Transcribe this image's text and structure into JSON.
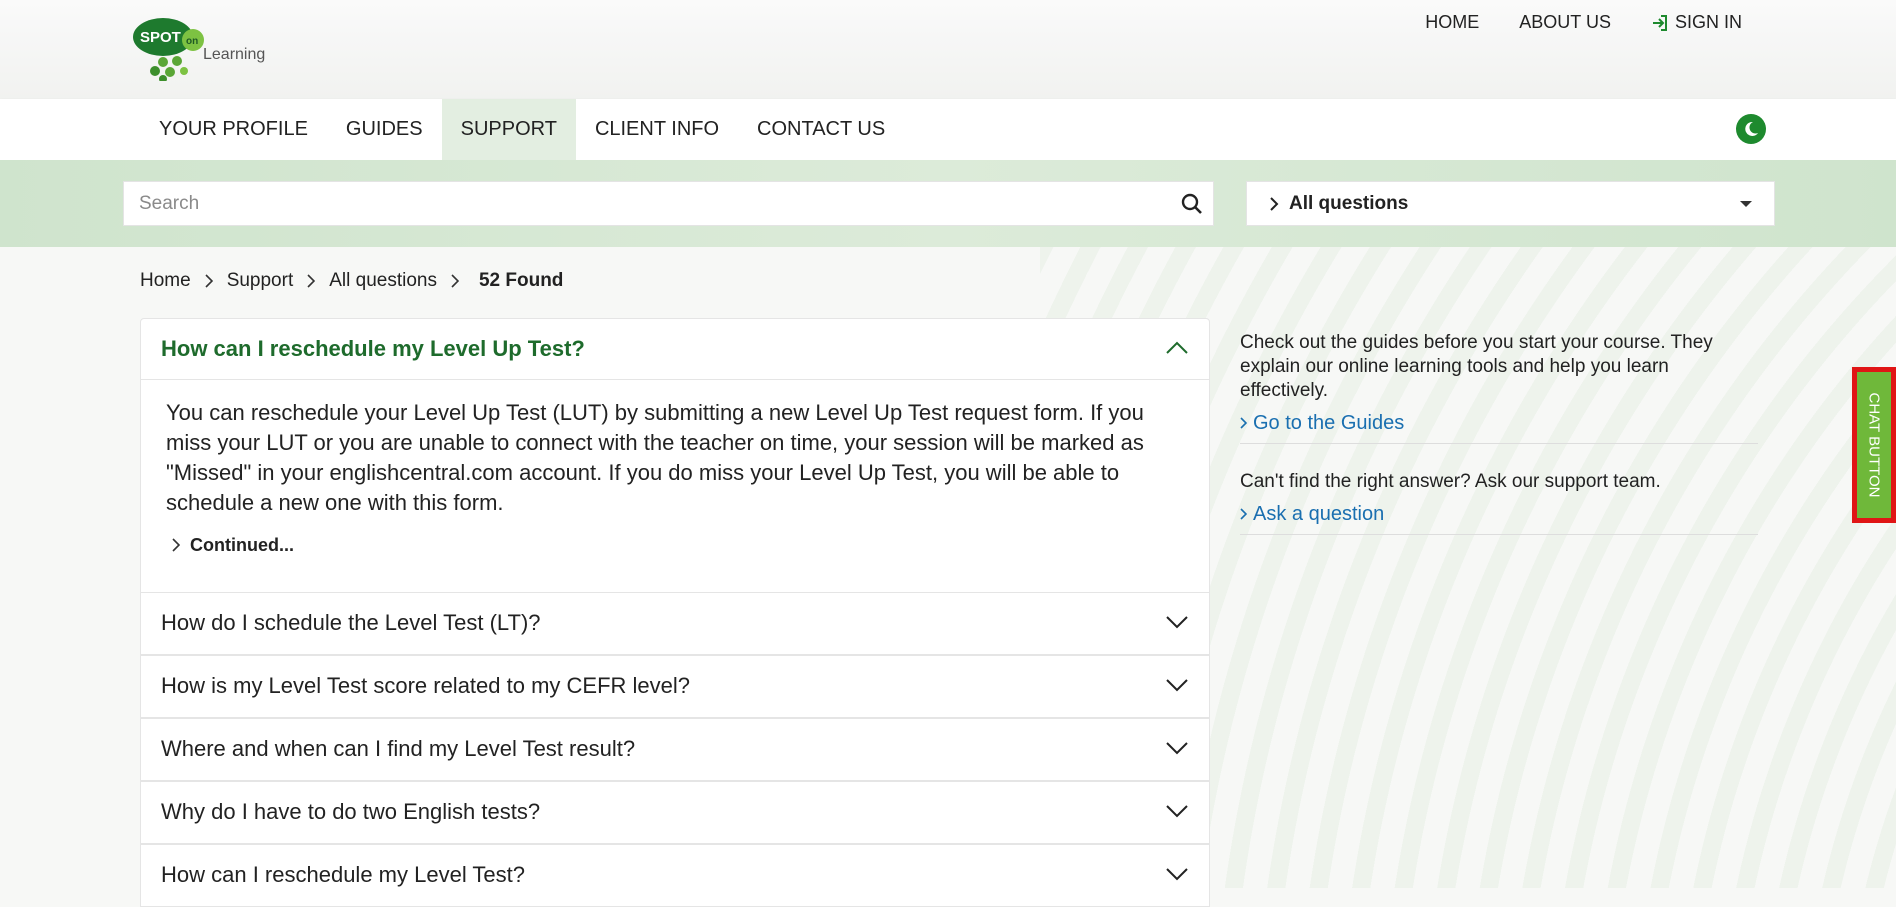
{
  "header": {
    "logo": {
      "spot": "SPOT",
      "on": "on",
      "learning": "Learning"
    },
    "links": [
      {
        "label": "HOME"
      },
      {
        "label": "ABOUT US"
      },
      {
        "label": "SIGN IN"
      }
    ]
  },
  "nav": {
    "items": [
      "YOUR PROFILE",
      "GUIDES",
      "SUPPORT",
      "CLIENT INFO",
      "CONTACT US"
    ],
    "active": "SUPPORT"
  },
  "search": {
    "placeholder": "Search",
    "value": ""
  },
  "filter": {
    "selected": "All questions"
  },
  "breadcrumb": {
    "items": [
      "Home",
      "Support",
      "All questions"
    ],
    "count": "52 Found"
  },
  "faq": {
    "open": {
      "question": "How can I reschedule my Level Up Test?",
      "answer": "You can reschedule your Level Up Test (LUT) by submitting a new Level Up Test request form. If you miss your LUT or you are unable to connect with the teacher on time, your session will be marked as \"Missed\" in your englishcentral.com account. If you do miss your Level Up Test, you will be able to schedule a new one with this form.",
      "continued": "Continued..."
    },
    "items": [
      "How do I schedule the Level Test (LT)?",
      "How is my Level Test score related to my CEFR level?",
      "Where and when can I find my Level Test result?",
      "Why do I have to do two English tests?",
      "How can I reschedule my Level Test?"
    ]
  },
  "sidebar": {
    "guides_text": "Check out the guides before you start your course. They explain our online learning tools and help you learn effectively.",
    "guides_link": "Go to the Guides",
    "support_text": "Can't find the right answer? Ask our support team.",
    "support_link": "Ask a question"
  },
  "chat": {
    "label": "CHAT BUTTON"
  },
  "colors": {
    "brand_green": "#1e8a2e",
    "link_blue": "#1a6fb0",
    "chat_green": "#6fb83a",
    "chat_border": "#e01515"
  }
}
